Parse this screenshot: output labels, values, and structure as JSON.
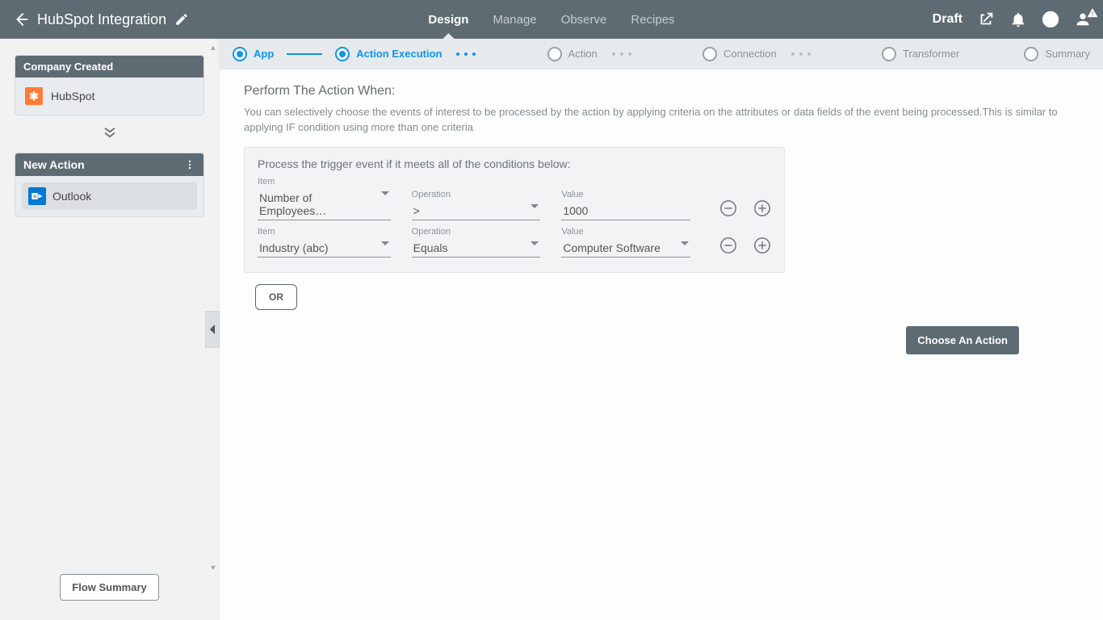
{
  "header": {
    "title": "HubSpot Integration",
    "tabs": [
      "Design",
      "Manage",
      "Observe",
      "Recipes"
    ],
    "activeTab": "Design",
    "status": "Draft"
  },
  "sidebar": {
    "card1_title": "Company Created",
    "card1_app": "HubSpot",
    "card2_title": "New Action",
    "card2_app": "Outlook",
    "flow_summary": "Flow Summary"
  },
  "steps": {
    "items": [
      "App",
      "Action Execution",
      "Action",
      "Connection",
      "Transformer",
      "Summary"
    ]
  },
  "content": {
    "section_title": "Perform The Action When:",
    "description": "You can selectively choose the events of interest to be processed by the action by applying criteria on the attributes or data fields of the event being processed.This is similar to applying IF condition using more than one criteria",
    "cond_title": "Process the trigger event if it meets all of the conditions below:",
    "labels": {
      "item": "Item",
      "operation": "Operation",
      "value": "Value"
    },
    "rows": [
      {
        "item": "Number of Employees…",
        "operation": ">",
        "value": "1000",
        "valueIsInput": true
      },
      {
        "item": "Industry (abc)",
        "operation": "Equals",
        "value": "Computer Software",
        "valueIsInput": false
      }
    ],
    "or_label": "OR",
    "choose_label": "Choose An Action"
  }
}
